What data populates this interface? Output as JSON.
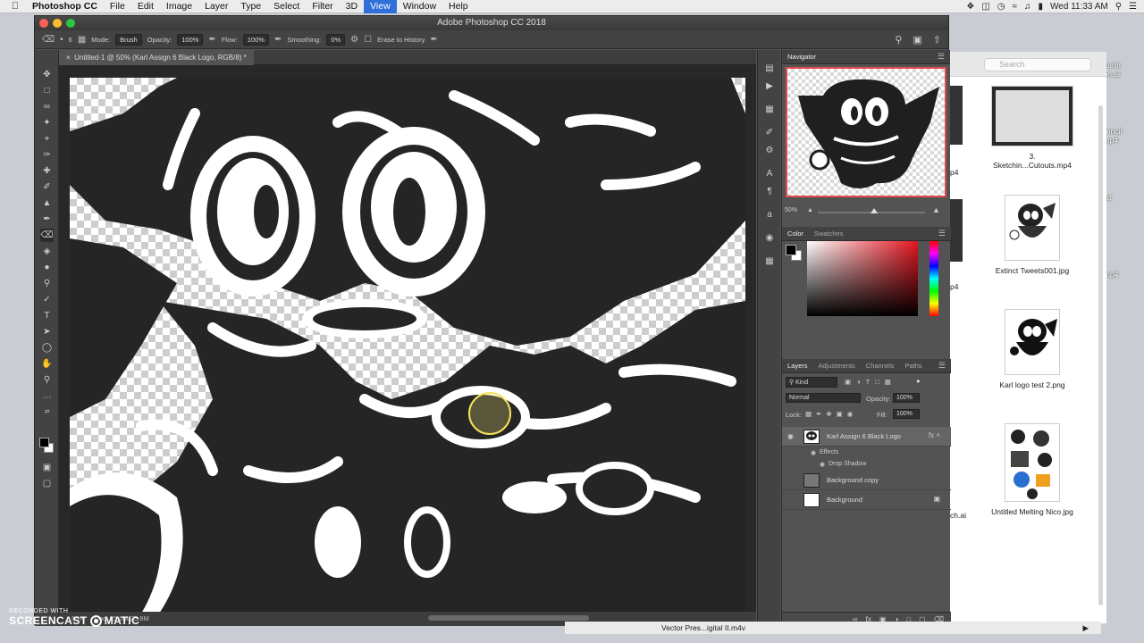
{
  "menubar": {
    "app": "Photoshop CC",
    "items": [
      "File",
      "Edit",
      "Image",
      "Layer",
      "Type",
      "Select",
      "Filter",
      "3D",
      "View",
      "Window",
      "Help"
    ],
    "active": "View",
    "clock": "Wed 11:33 AM"
  },
  "window": {
    "title": "Adobe Photoshop CC 2018"
  },
  "options": {
    "brush_size": "6",
    "mode_label": "Mode:",
    "mode_value": "Brush",
    "opacity_label": "Opacity:",
    "opacity_value": "100%",
    "flow_label": "Flow:",
    "flow_value": "100%",
    "smoothing_label": "Smoothing:",
    "smoothing_value": "0%",
    "erase_history": "Erase to History"
  },
  "document": {
    "tab_label": "Untitled-1 @ 50% (Karl Assign 6 Black Logo, RGB/8) *",
    "status_zoom": "50%",
    "status_doc": "Doc: 25.0M/25.8M"
  },
  "navigator": {
    "title": "Navigator",
    "zoom": "50%"
  },
  "color_panel": {
    "tabs": [
      "Color",
      "Swatches"
    ]
  },
  "layers_panel": {
    "tabs": [
      "Layers",
      "Adjustments",
      "Channels",
      "Paths"
    ],
    "kind": "Kind",
    "blend_mode": "Normal",
    "opacity_label": "Opacity:",
    "opacity_value": "100%",
    "lock_label": "Lock:",
    "fill_label": "Fill:",
    "fill_value": "100%",
    "layers": [
      {
        "name": "Karl Assign 6 Black Logo"
      },
      {
        "name": "Background copy"
      },
      {
        "name": "Background"
      }
    ],
    "effects_label": "Effects",
    "effect_name": "Drop Shadow"
  },
  "finder": {
    "search_placeholder": "Search",
    "files": [
      {
        "name": "3. Sketchin...Cutouts.mp4"
      },
      {
        "name": "Extinct Tweets001.jpg"
      },
      {
        "name": "Karl logo test 2.png"
      },
      {
        "name": "Untitled Melting Nico.jpg"
      }
    ],
    "partial": [
      "p4",
      "p4",
      "ch.ai"
    ],
    "dock_label": "Vector Pres...igital II.m4v"
  },
  "desktop": {
    "items": [
      "inal Earth",
      ".tration.ai",
      "the Pencil",
      "ator.mp4",
      "go test",
      "eps",
      "sing",
      "..kly.mp4"
    ]
  },
  "watermark": {
    "line1": "RECORDED WITH",
    "line2a": "SCREENCAST",
    "line2b": "MATIC"
  }
}
